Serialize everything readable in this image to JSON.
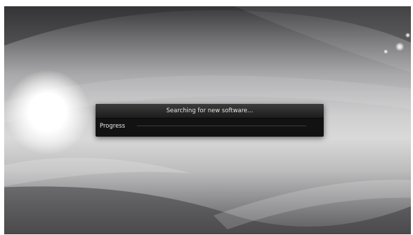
{
  "dialog": {
    "title": "Searching for new software...",
    "progress_label": "Progress",
    "progress_value": 0
  }
}
